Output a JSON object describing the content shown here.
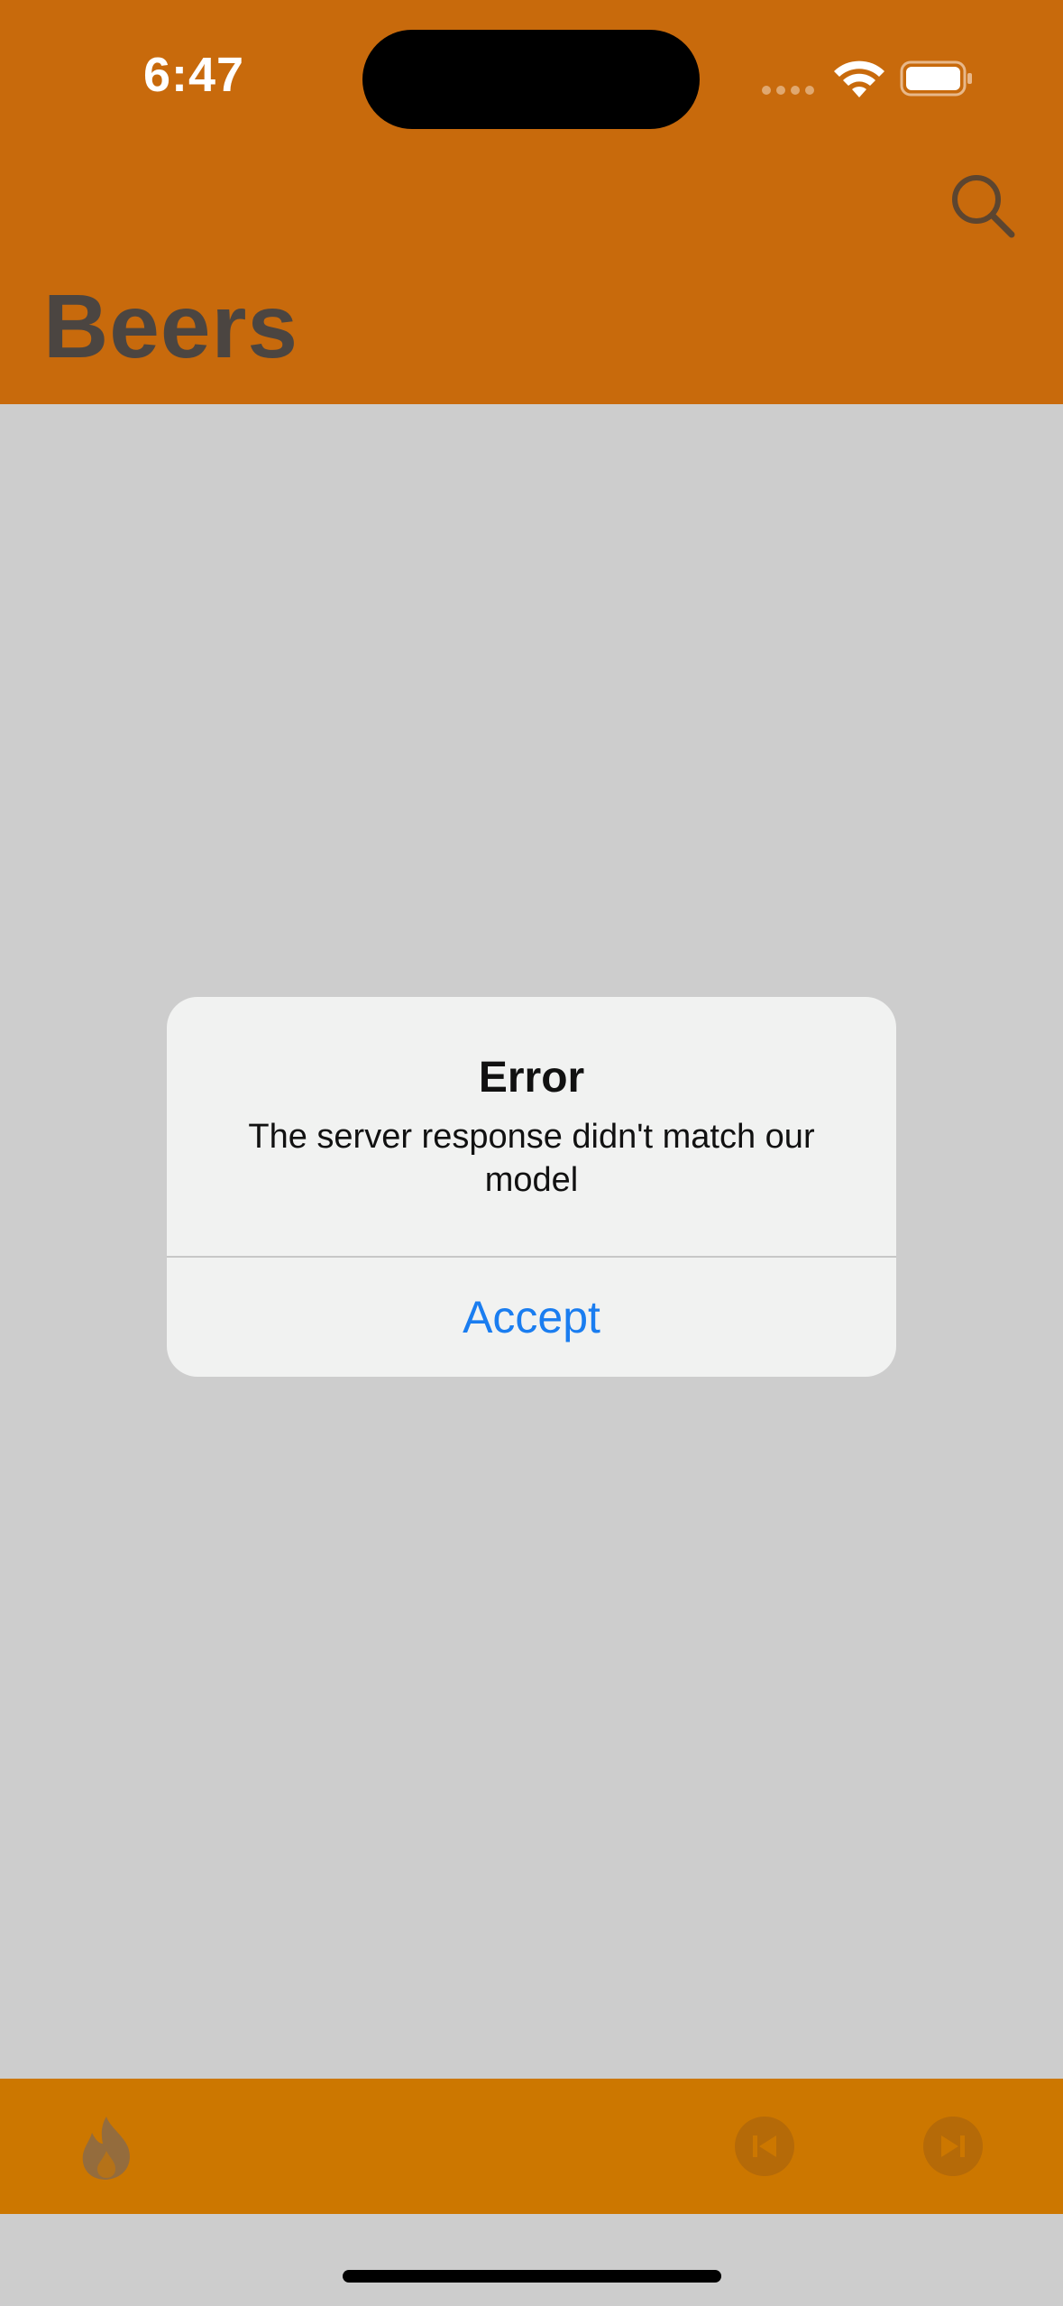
{
  "status_bar": {
    "time": "6:47"
  },
  "header": {
    "title": "Beers",
    "background_color": "#c86a0c",
    "search_icon": "search-icon"
  },
  "alert": {
    "title": "Error",
    "message": "The server response didn't match our model",
    "accept_label": "Accept",
    "accept_color": "#1a7df0"
  },
  "toolbar": {
    "background_color": "#cc7700",
    "left_icon": "flame-icon",
    "right_icons": [
      "previous-icon",
      "next-icon"
    ]
  },
  "colors": {
    "background": "#cdcdcd",
    "title_text": "#4b4541"
  }
}
